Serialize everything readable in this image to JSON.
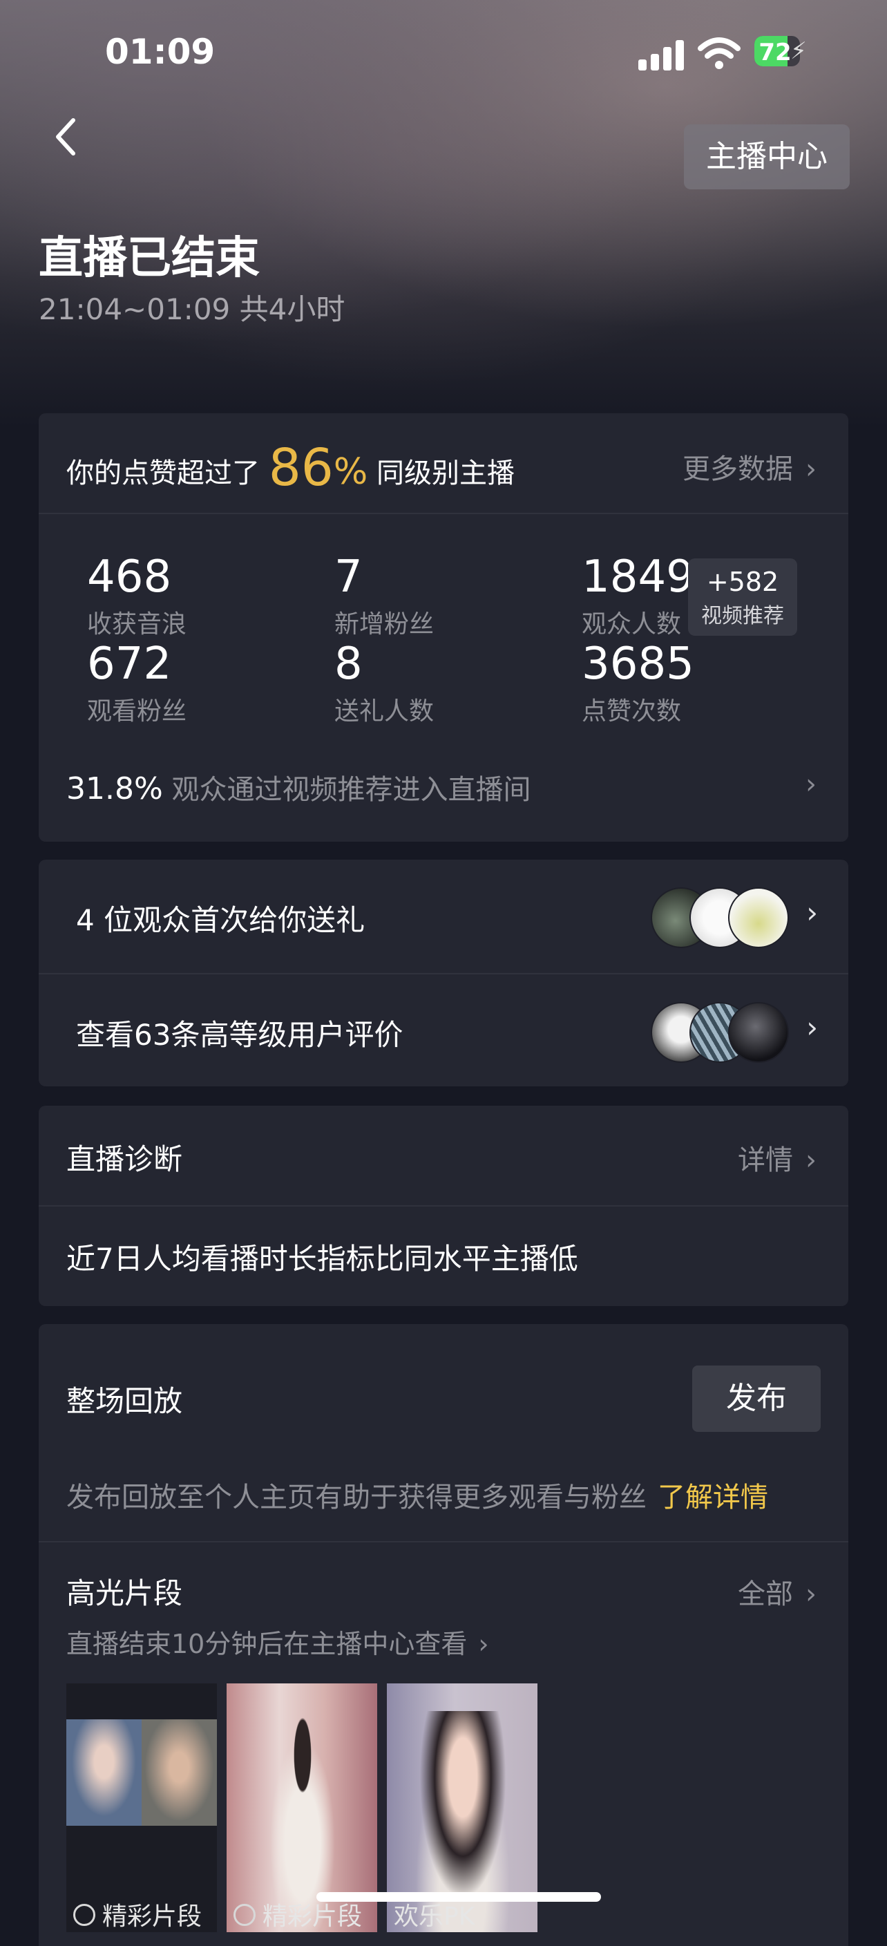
{
  "status_bar": {
    "time": "01:09",
    "battery": "72",
    "battery_level": 0.72
  },
  "header": {
    "anchor_center_label": "主播中心",
    "title": "直播已结束",
    "subtitle": "21:04~01:09 共4小时"
  },
  "summary": {
    "headline_prefix": "你的点赞超过了",
    "percent_value": "86",
    "percent_sign": "%",
    "headline_suffix": "同级别主播",
    "more_label": "更多数据",
    "stats": [
      {
        "value": "468",
        "label": "收获音浪"
      },
      {
        "value": "7",
        "label": "新增粉丝"
      },
      {
        "value": "1849",
        "label": "观众人数"
      },
      {
        "value": "672",
        "label": "观看粉丝"
      },
      {
        "value": "8",
        "label": "送礼人数"
      },
      {
        "value": "3685",
        "label": "点赞次数"
      }
    ],
    "badge": {
      "value": "+582",
      "label": "视频推荐"
    },
    "footer_percent": "31.8%",
    "footer_text": "观众通过视频推荐进入直播间"
  },
  "viewers": {
    "first_gift": "4 位观众首次给你送礼",
    "reviews": "查看63条高等级用户评价"
  },
  "diagnosis": {
    "title": "直播诊断",
    "detail_label": "详情",
    "description": "近7日人均看播时长指标比同水平主播低"
  },
  "replay": {
    "title": "整场回放",
    "publish_label": "发布",
    "hint": "发布回放至个人主页有助于获得更多观看与粉丝",
    "learn_more": "了解详情",
    "highlights_title": "高光片段",
    "all_label": "全部",
    "highlights_note": "直播结束10分钟后在主播中心查看",
    "clips": [
      {
        "caption": "精彩片段"
      },
      {
        "caption": "精彩片段"
      },
      {
        "caption": "欢乐PK"
      }
    ]
  },
  "colors": {
    "accent_gold": "#e9b847",
    "link_yellow": "#f2c84b",
    "background": "#161823",
    "card": "#242631"
  }
}
